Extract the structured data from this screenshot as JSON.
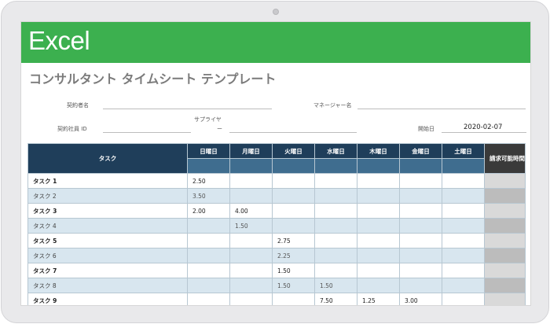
{
  "app": {
    "name": "Excel"
  },
  "sheet": {
    "title": "コンサルタント タイムシート テンプレート"
  },
  "form": {
    "contractor_label": "契約者名",
    "contractor_value": "",
    "manager_label": "マネージャー名",
    "manager_value": "",
    "employee_id_label": "契約社員 ID",
    "employee_id_value": "",
    "supplier_label_line1": "サプライヤ",
    "supplier_label_line2": "ー",
    "supplier_value": "",
    "start_date_label": "開始日",
    "start_date_value": "2020-02-07"
  },
  "table": {
    "task_header": "タスク",
    "day_headers": [
      "日曜日",
      "月曜日",
      "火曜日",
      "水曜日",
      "木曜日",
      "金曜日",
      "土曜日"
    ],
    "total_header": "請求可能時間の合計",
    "rows": [
      {
        "task": "タスク 1",
        "days": [
          "2.50",
          "",
          "",
          "",
          "",
          "",
          ""
        ],
        "total": ""
      },
      {
        "task": "タスク 2",
        "days": [
          "3.50",
          "",
          "",
          "",
          "",
          "",
          ""
        ],
        "total": ""
      },
      {
        "task": "タスク 3",
        "days": [
          "2.00",
          "4.00",
          "",
          "",
          "",
          "",
          ""
        ],
        "total": ""
      },
      {
        "task": "タスク 4",
        "days": [
          "",
          "1.50",
          "",
          "",
          "",
          "",
          ""
        ],
        "total": ""
      },
      {
        "task": "タスク 5",
        "days": [
          "",
          "",
          "2.75",
          "",
          "",
          "",
          ""
        ],
        "total": ""
      },
      {
        "task": "タスク 6",
        "days": [
          "",
          "",
          "2.25",
          "",
          "",
          "",
          ""
        ],
        "total": ""
      },
      {
        "task": "タスク 7",
        "days": [
          "",
          "",
          "1.50",
          "",
          "",
          "",
          ""
        ],
        "total": ""
      },
      {
        "task": "タスク 8",
        "days": [
          "",
          "",
          "1.50",
          "1.50",
          "",
          "",
          ""
        ],
        "total": ""
      },
      {
        "task": "タスク 9",
        "days": [
          "",
          "",
          "",
          "7.50",
          "1.25",
          "3.00",
          ""
        ],
        "total": ""
      }
    ]
  },
  "colors": {
    "banner": "#3cb04f",
    "header_dark": "#1f3e5a",
    "header_mid": "#3f6d8f",
    "total_header": "#3a3a3a",
    "row_alt": "#d8e6ef"
  }
}
